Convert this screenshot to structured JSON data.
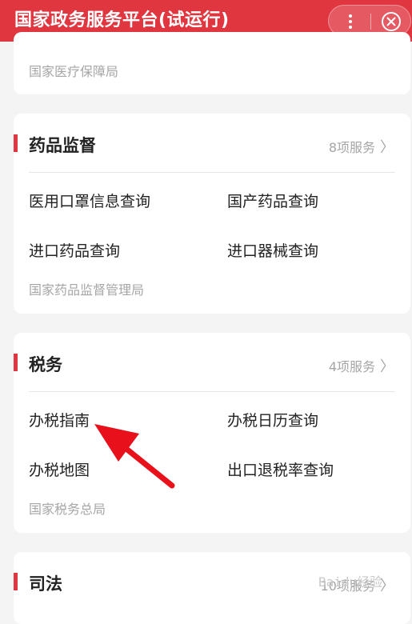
{
  "header": {
    "title": "国家政务服务平台(试运行)"
  },
  "prev_section": {
    "agency": "国家医疗保障局"
  },
  "sections": [
    {
      "title": "药品监督",
      "count": "8项服务",
      "items": [
        "医用口罩信息查询",
        "国产药品查询",
        "进口药品查询",
        "进口器械查询"
      ],
      "agency": "国家药品监督管理局"
    },
    {
      "title": "税务",
      "count": "4项服务",
      "items": [
        "办税指南",
        "办税日历查询",
        "办税地图",
        "出口退税率查询"
      ],
      "agency": "国家税务总局"
    },
    {
      "title": "司法",
      "count": "10项服务"
    }
  ],
  "colors": {
    "accent": "#e03640",
    "arrow": "#e8101a"
  },
  "watermark": "Baidu经验"
}
